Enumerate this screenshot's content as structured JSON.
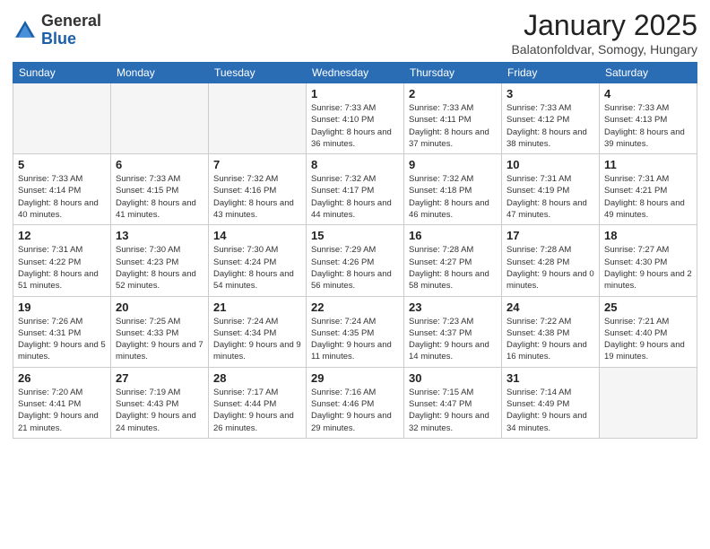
{
  "header": {
    "logo_general": "General",
    "logo_blue": "Blue",
    "month_title": "January 2025",
    "location": "Balatonfoldvar, Somogy, Hungary"
  },
  "weekdays": [
    "Sunday",
    "Monday",
    "Tuesday",
    "Wednesday",
    "Thursday",
    "Friday",
    "Saturday"
  ],
  "weeks": [
    [
      {
        "day": "",
        "info": ""
      },
      {
        "day": "",
        "info": ""
      },
      {
        "day": "",
        "info": ""
      },
      {
        "day": "1",
        "info": "Sunrise: 7:33 AM\nSunset: 4:10 PM\nDaylight: 8 hours and 36 minutes."
      },
      {
        "day": "2",
        "info": "Sunrise: 7:33 AM\nSunset: 4:11 PM\nDaylight: 8 hours and 37 minutes."
      },
      {
        "day": "3",
        "info": "Sunrise: 7:33 AM\nSunset: 4:12 PM\nDaylight: 8 hours and 38 minutes."
      },
      {
        "day": "4",
        "info": "Sunrise: 7:33 AM\nSunset: 4:13 PM\nDaylight: 8 hours and 39 minutes."
      }
    ],
    [
      {
        "day": "5",
        "info": "Sunrise: 7:33 AM\nSunset: 4:14 PM\nDaylight: 8 hours and 40 minutes."
      },
      {
        "day": "6",
        "info": "Sunrise: 7:33 AM\nSunset: 4:15 PM\nDaylight: 8 hours and 41 minutes."
      },
      {
        "day": "7",
        "info": "Sunrise: 7:32 AM\nSunset: 4:16 PM\nDaylight: 8 hours and 43 minutes."
      },
      {
        "day": "8",
        "info": "Sunrise: 7:32 AM\nSunset: 4:17 PM\nDaylight: 8 hours and 44 minutes."
      },
      {
        "day": "9",
        "info": "Sunrise: 7:32 AM\nSunset: 4:18 PM\nDaylight: 8 hours and 46 minutes."
      },
      {
        "day": "10",
        "info": "Sunrise: 7:31 AM\nSunset: 4:19 PM\nDaylight: 8 hours and 47 minutes."
      },
      {
        "day": "11",
        "info": "Sunrise: 7:31 AM\nSunset: 4:21 PM\nDaylight: 8 hours and 49 minutes."
      }
    ],
    [
      {
        "day": "12",
        "info": "Sunrise: 7:31 AM\nSunset: 4:22 PM\nDaylight: 8 hours and 51 minutes."
      },
      {
        "day": "13",
        "info": "Sunrise: 7:30 AM\nSunset: 4:23 PM\nDaylight: 8 hours and 52 minutes."
      },
      {
        "day": "14",
        "info": "Sunrise: 7:30 AM\nSunset: 4:24 PM\nDaylight: 8 hours and 54 minutes."
      },
      {
        "day": "15",
        "info": "Sunrise: 7:29 AM\nSunset: 4:26 PM\nDaylight: 8 hours and 56 minutes."
      },
      {
        "day": "16",
        "info": "Sunrise: 7:28 AM\nSunset: 4:27 PM\nDaylight: 8 hours and 58 minutes."
      },
      {
        "day": "17",
        "info": "Sunrise: 7:28 AM\nSunset: 4:28 PM\nDaylight: 9 hours and 0 minutes."
      },
      {
        "day": "18",
        "info": "Sunrise: 7:27 AM\nSunset: 4:30 PM\nDaylight: 9 hours and 2 minutes."
      }
    ],
    [
      {
        "day": "19",
        "info": "Sunrise: 7:26 AM\nSunset: 4:31 PM\nDaylight: 9 hours and 5 minutes."
      },
      {
        "day": "20",
        "info": "Sunrise: 7:25 AM\nSunset: 4:33 PM\nDaylight: 9 hours and 7 minutes."
      },
      {
        "day": "21",
        "info": "Sunrise: 7:24 AM\nSunset: 4:34 PM\nDaylight: 9 hours and 9 minutes."
      },
      {
        "day": "22",
        "info": "Sunrise: 7:24 AM\nSunset: 4:35 PM\nDaylight: 9 hours and 11 minutes."
      },
      {
        "day": "23",
        "info": "Sunrise: 7:23 AM\nSunset: 4:37 PM\nDaylight: 9 hours and 14 minutes."
      },
      {
        "day": "24",
        "info": "Sunrise: 7:22 AM\nSunset: 4:38 PM\nDaylight: 9 hours and 16 minutes."
      },
      {
        "day": "25",
        "info": "Sunrise: 7:21 AM\nSunset: 4:40 PM\nDaylight: 9 hours and 19 minutes."
      }
    ],
    [
      {
        "day": "26",
        "info": "Sunrise: 7:20 AM\nSunset: 4:41 PM\nDaylight: 9 hours and 21 minutes."
      },
      {
        "day": "27",
        "info": "Sunrise: 7:19 AM\nSunset: 4:43 PM\nDaylight: 9 hours and 24 minutes."
      },
      {
        "day": "28",
        "info": "Sunrise: 7:17 AM\nSunset: 4:44 PM\nDaylight: 9 hours and 26 minutes."
      },
      {
        "day": "29",
        "info": "Sunrise: 7:16 AM\nSunset: 4:46 PM\nDaylight: 9 hours and 29 minutes."
      },
      {
        "day": "30",
        "info": "Sunrise: 7:15 AM\nSunset: 4:47 PM\nDaylight: 9 hours and 32 minutes."
      },
      {
        "day": "31",
        "info": "Sunrise: 7:14 AM\nSunset: 4:49 PM\nDaylight: 9 hours and 34 minutes."
      },
      {
        "day": "",
        "info": ""
      }
    ]
  ]
}
